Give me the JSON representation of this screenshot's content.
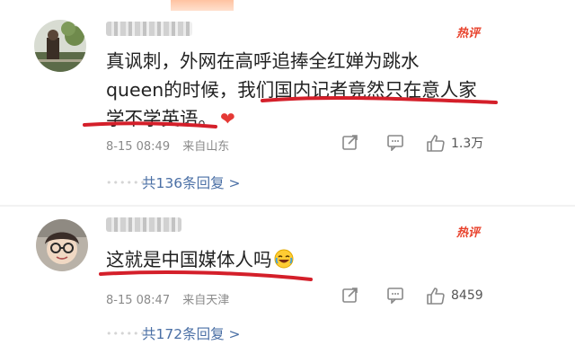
{
  "comments": [
    {
      "hot_tag": "热评",
      "lines": [
        "真讽刺，外网在高呼追捧全红婵为跳水",
        "queen的时候，我们国内记者竟然只在意人家",
        "学不学英语。"
      ],
      "date": "8-15 08:49",
      "location": "来自山东",
      "like_count": "1.3万",
      "replies_label": "共136条回复 >"
    },
    {
      "hot_tag": "热评",
      "lines": [
        "这就是中国媒体人吗"
      ],
      "date": "8-15 08:47",
      "location": "来自天津",
      "like_count": "8459",
      "replies_label": "共172条回复 >"
    }
  ],
  "icons": {
    "heart": "red-heart",
    "laugh": "laughing-crying-emoji",
    "share": "share-icon",
    "comment": "comment-icon",
    "like": "thumbs-up-icon"
  },
  "colors": {
    "hot_tag": "#e8412b",
    "highlight": "#d41f2a",
    "link": "#4a6fa5"
  }
}
